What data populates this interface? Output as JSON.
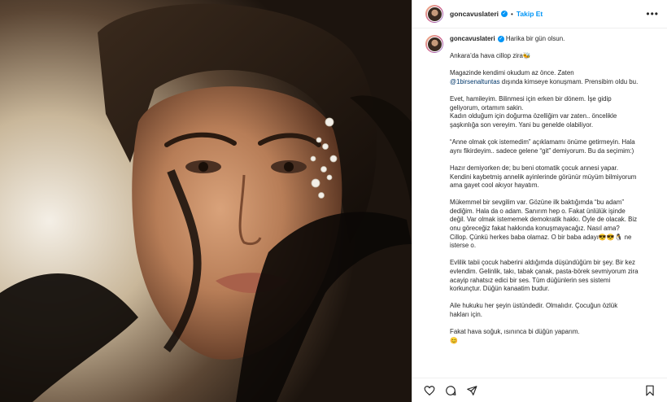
{
  "post": {
    "username": "goncavuslateri",
    "follow_label": "Takip Et",
    "separator": "•",
    "more_label": "•••"
  },
  "caption": {
    "username": "goncavuslateri",
    "first_line": "Harika bir gün olsun.",
    "paragraphs": [
      "Ankara’da hava cillop zira🐝",
      "",
      "Magazinde kendimi okudum az önce. Zaten",
      "@1birsenaltuntas dışında kimseye konuşmam. Prensibim oldu bu.",
      "",
      "Evet, hamileyim. Bilinmesi için erken bir dönem. İşe gidip geliyorum, ortamım sakin.",
      "Kadın olduğum için doğurma özelliğim var zaten.. öncelikle şaşkınlığa son vereyim. Yani bu genelde olabiliyor.",
      "",
      "“Anne olmak çok istemedim” açıklamamı önüme getirmeyin. Hala aynı fikirdeyim.. sadece gelene “git” demiyorum. Bu da seçimim:)",
      "",
      "Hazır demiyorken de; bu beni otomatik çocuk annesi yapar. Kendini kaybetmiş annelik ayinlerinde görünür müyüm bilmiyorum ama gayet cool akıyor hayatım.",
      "",
      "Mükemmel bir sevgilim var. Gözüne ilk baktığımda “bu adam” dediğim. Hala da o adam. Sanırım hep o. Fakat ünlülük işinde değil. Var olmak istememek demokratik hakkı. Öyle de olacak. Biz onu göreceğiz fakat hakkında konuşmayacağız. Nasıl ama? Cillop. Çünkü herkes baba olamaz. O bir baba adayı😎😎🐧 ne isterse o.",
      "",
      "Evlilik tabii çocuk haberini aldığımda düşündüğüm bir şey. Bir kez evlendim. Gelinlik, takı, tabak çanak, pasta-börek sevmiyorum zira acayip rahatsız edici bir ses. Tüm düğünlerin ses sistemi korkunçtur. Düğün kanaatim budur.",
      "",
      "Aile hukuku her şeyin üstündedir. Olmalıdır. Çocuğun özlük hakları için.",
      "",
      "Fakat hava soğuk, ısınınca bi düğün yaparım.",
      "😊"
    ]
  },
  "colors": {
    "accent": "#0095f6",
    "text": "#262626",
    "mention": "#00376b",
    "border": "#dbdbdb"
  },
  "icons": [
    "verified-icon",
    "more-icon",
    "heart-icon",
    "comment-icon",
    "share-icon",
    "bookmark-icon"
  ]
}
